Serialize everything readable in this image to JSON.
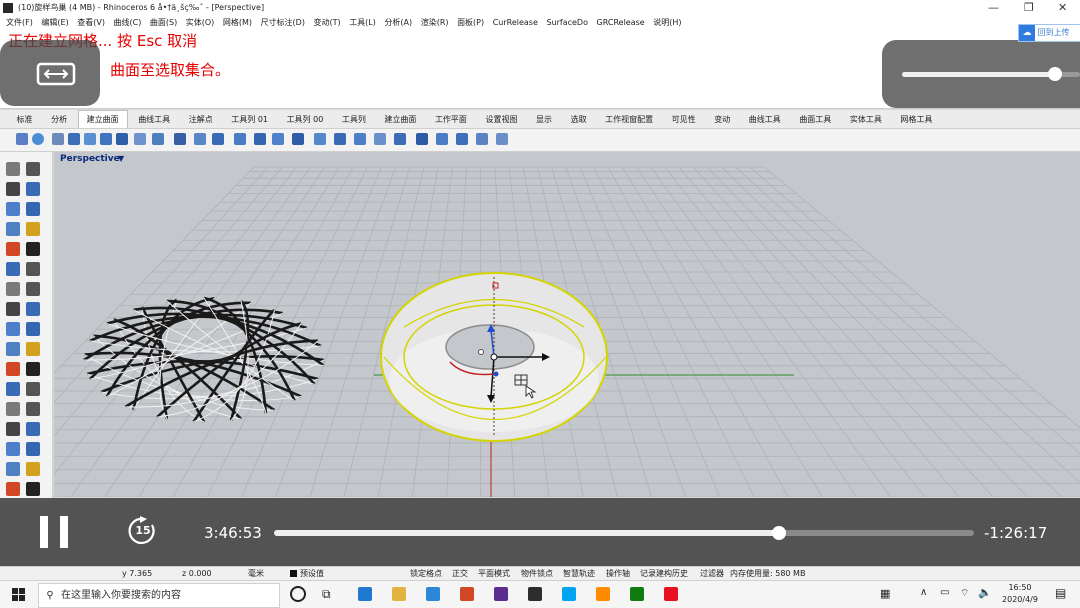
{
  "window": {
    "title": "(10)旋样鸟巢 (4 MB) - Rhinoceros 6 å•†ä¸šç‰ˆ - [Perspective]"
  },
  "menu": [
    "文件(F)",
    "编辑(E)",
    "查看(V)",
    "曲线(C)",
    "曲面(S)",
    "实体(O)",
    "网格(M)",
    "尺寸标注(D)",
    "变动(T)",
    "工具(L)",
    "分析(A)",
    "渲染(R)",
    "面板(P)",
    "CurRelease",
    "SurfaceDo",
    "GRCRelease",
    "说明(H)"
  ],
  "command": {
    "line1": "正在建立网格... 按 Esc 取消",
    "line2": "曲面至选取集合。"
  },
  "cloud_label": "回到上传",
  "tabs": [
    "标准",
    "分析",
    "建立曲面",
    "曲线工具",
    "注解点",
    "工具列 01",
    "工具列 00",
    "工具列",
    "建立曲面",
    "工作平面",
    "设置视图",
    "显示",
    "选取",
    "工作视窗配置",
    "可见性",
    "变动",
    "曲线工具",
    "曲面工具",
    "实体工具",
    "网格工具"
  ],
  "active_tab_index": 2,
  "viewport": {
    "label": "Perspective",
    "menu_arrow": "▼"
  },
  "player": {
    "elapsed": "3:46:53",
    "remaining": "-1:26:17",
    "progress_fraction": 0.722,
    "skip_seconds": "15",
    "volume_fraction": 0.86
  },
  "status": {
    "y": "y 7.365",
    "z": "z 0.000",
    "unit": "毫米",
    "layer": "预设值",
    "snaps": [
      "锁定格点",
      "正交",
      "平面模式",
      "物件锁点",
      "智慧轨迹",
      "操作轴",
      "记录建构历史",
      "过滤器"
    ],
    "memory": "内存使用量: 580 MB"
  },
  "taskbar": {
    "search_placeholder": "在这里输入你要搜索的内容",
    "time": "16:50",
    "date": "2020/4/9"
  }
}
